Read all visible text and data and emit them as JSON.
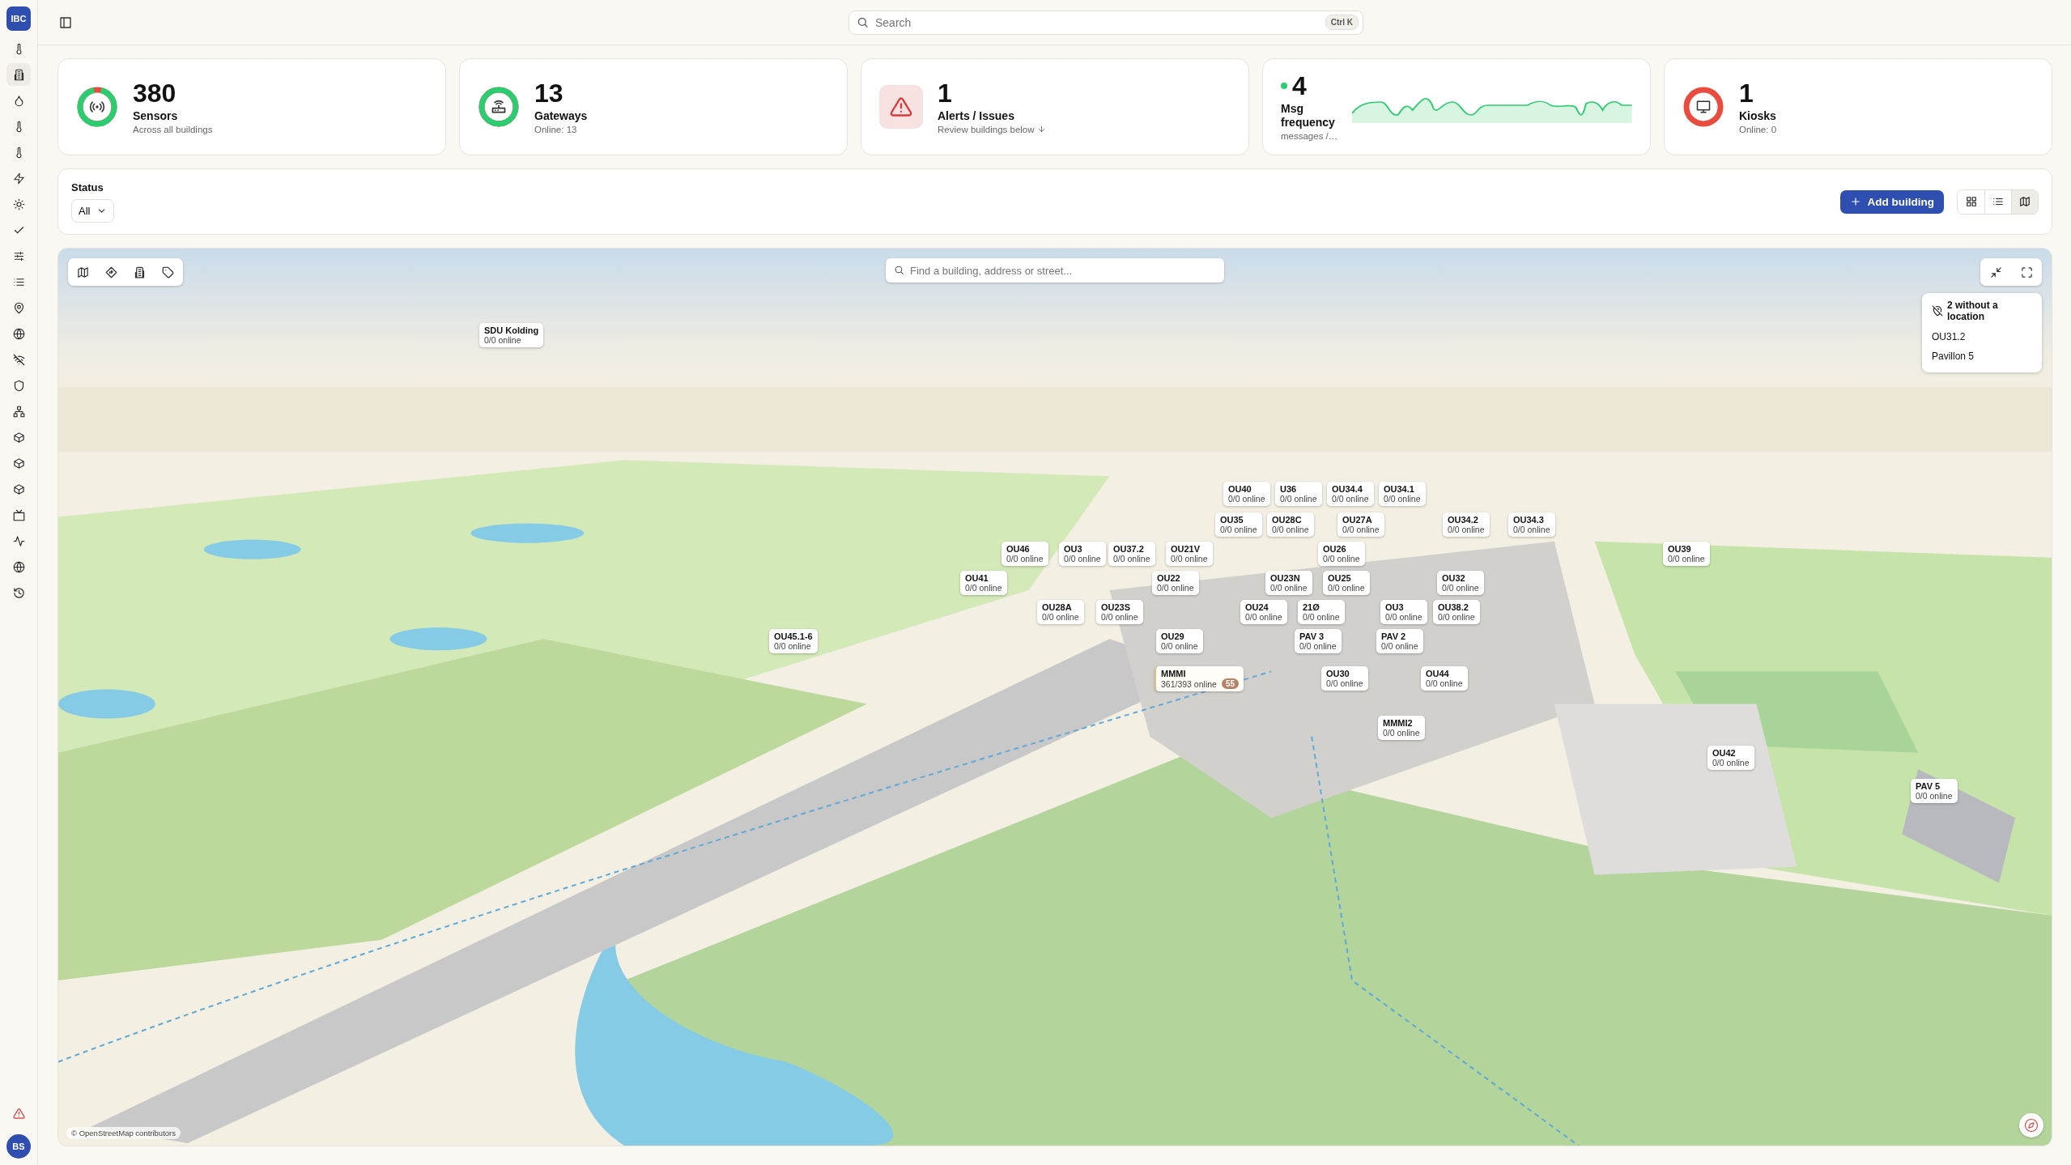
{
  "sidebar": {
    "logo": "IBC",
    "items": [
      {
        "kind": "thermometer",
        "selected": false
      },
      {
        "kind": "building",
        "selected": true
      },
      {
        "kind": "drop",
        "selected": false
      },
      {
        "kind": "thermometer",
        "selected": false
      },
      {
        "kind": "thermometer",
        "selected": false
      },
      {
        "kind": "bolt",
        "selected": false
      },
      {
        "kind": "sun",
        "selected": false
      },
      {
        "kind": "check",
        "selected": false
      },
      {
        "kind": "sliders",
        "selected": false
      },
      {
        "kind": "list",
        "selected": false
      },
      {
        "kind": "pin",
        "selected": false
      },
      {
        "kind": "globe",
        "selected": false
      },
      {
        "kind": "wifi-off",
        "selected": false
      },
      {
        "kind": "shield",
        "selected": false
      },
      {
        "kind": "network",
        "selected": false
      },
      {
        "kind": "cube",
        "selected": false
      },
      {
        "kind": "cube",
        "selected": false
      },
      {
        "kind": "cube",
        "selected": false
      },
      {
        "kind": "tv",
        "selected": false
      },
      {
        "kind": "activity",
        "selected": false
      },
      {
        "kind": "globe",
        "selected": false
      },
      {
        "kind": "history",
        "selected": false
      }
    ],
    "avatar": "BS"
  },
  "topbar": {
    "search": {
      "placeholder": "Search",
      "shortcut": "Ctrl K"
    }
  },
  "stats": [
    {
      "kind": "sensors",
      "value": "380",
      "label": "Sensors",
      "caption": "Across all buildings",
      "level": 0.93
    },
    {
      "kind": "gateways",
      "value": "13",
      "label": "Gateways",
      "caption": "Online: 13",
      "level": 1
    },
    {
      "kind": "alerts",
      "value": "1",
      "label": "Alerts / Issues",
      "caption": "Review buildings below"
    },
    {
      "kind": "frequency",
      "value": "4",
      "label": "Msg frequency",
      "caption": "messages /…",
      "live": true
    },
    {
      "kind": "kiosks",
      "value": "1",
      "label": "Kiosks",
      "caption": "Online: 0",
      "level": 0
    }
  ],
  "filters": {
    "label": "Status",
    "value": "All",
    "add_button": "Add building",
    "views": [
      {
        "kind": "grid",
        "selected": false
      },
      {
        "kind": "list",
        "selected": false
      },
      {
        "kind": "map",
        "selected": true
      }
    ]
  },
  "map": {
    "tools": [
      {
        "kind": "map"
      },
      {
        "kind": "direction"
      },
      {
        "kind": "building"
      },
      {
        "kind": "tag"
      }
    ],
    "search": {
      "placeholder": "Find a building, address or street..."
    },
    "unlocated": {
      "title": "2 without a location",
      "items": [
        "OU31.2",
        "Pavillon 5"
      ]
    },
    "markers": [
      {
        "name": "SDU Kolding",
        "status": "0/0 online"
      },
      {
        "name": "OU40",
        "status": "0/0 online"
      },
      {
        "name": "U36",
        "status": "0/0 online"
      },
      {
        "name": "OU34.4",
        "status": "0/0 online"
      },
      {
        "name": "OU34.1",
        "status": "0/0 online"
      },
      {
        "name": "OU35",
        "status": "0/0 online"
      },
      {
        "name": "OU28C",
        "status": "0/0 online"
      },
      {
        "name": "OU27A",
        "status": "0/0 online"
      },
      {
        "name": "OU34.2",
        "status": "0/0 online"
      },
      {
        "name": "OU34.3",
        "status": "0/0 online"
      },
      {
        "name": "OU46",
        "status": "0/0 online"
      },
      {
        "name": "OU3",
        "status": "0/0 online"
      },
      {
        "name": "OU37.2",
        "status": "0/0 online"
      },
      {
        "name": "OU21V",
        "status": "0/0 online"
      },
      {
        "name": "OU26",
        "status": "0/0 online"
      },
      {
        "name": "OU39",
        "status": "0/0 online"
      },
      {
        "name": "OU41",
        "status": "0/0 online"
      },
      {
        "name": "OU22",
        "status": "0/0 online"
      },
      {
        "name": "OU23N",
        "status": "0/0 online"
      },
      {
        "name": "OU25",
        "status": "0/0 online"
      },
      {
        "name": "OU32",
        "status": "0/0 online"
      },
      {
        "name": "OU28A",
        "status": "0/0 online"
      },
      {
        "name": "OU23S",
        "status": "0/0 online"
      },
      {
        "name": "OU24",
        "status": "0/0 online"
      },
      {
        "name": "21Ø",
        "status": "0/0 online"
      },
      {
        "name": "OU3",
        "status": "0/0 online"
      },
      {
        "name": "OU38.2",
        "status": "0/0 online"
      },
      {
        "name": "OU45.1-6",
        "status": "0/0 online"
      },
      {
        "name": "OU29",
        "status": "0/0 online"
      },
      {
        "name": "PAV 3",
        "status": "0/0 online"
      },
      {
        "name": "PAV 2",
        "status": "0/0 online"
      },
      {
        "name": "MMMI",
        "status": "361/393 online",
        "badge": "55"
      },
      {
        "name": "OU30",
        "status": "0/0 online"
      },
      {
        "name": "OU44",
        "status": "0/0 online"
      },
      {
        "name": "MMMI2",
        "status": "0/0 online"
      },
      {
        "name": "OU42",
        "status": "0/0 online"
      },
      {
        "name": "PAV 5",
        "status": "0/0 online"
      }
    ],
    "attribution": "© OpenStreetMap contributors"
  }
}
